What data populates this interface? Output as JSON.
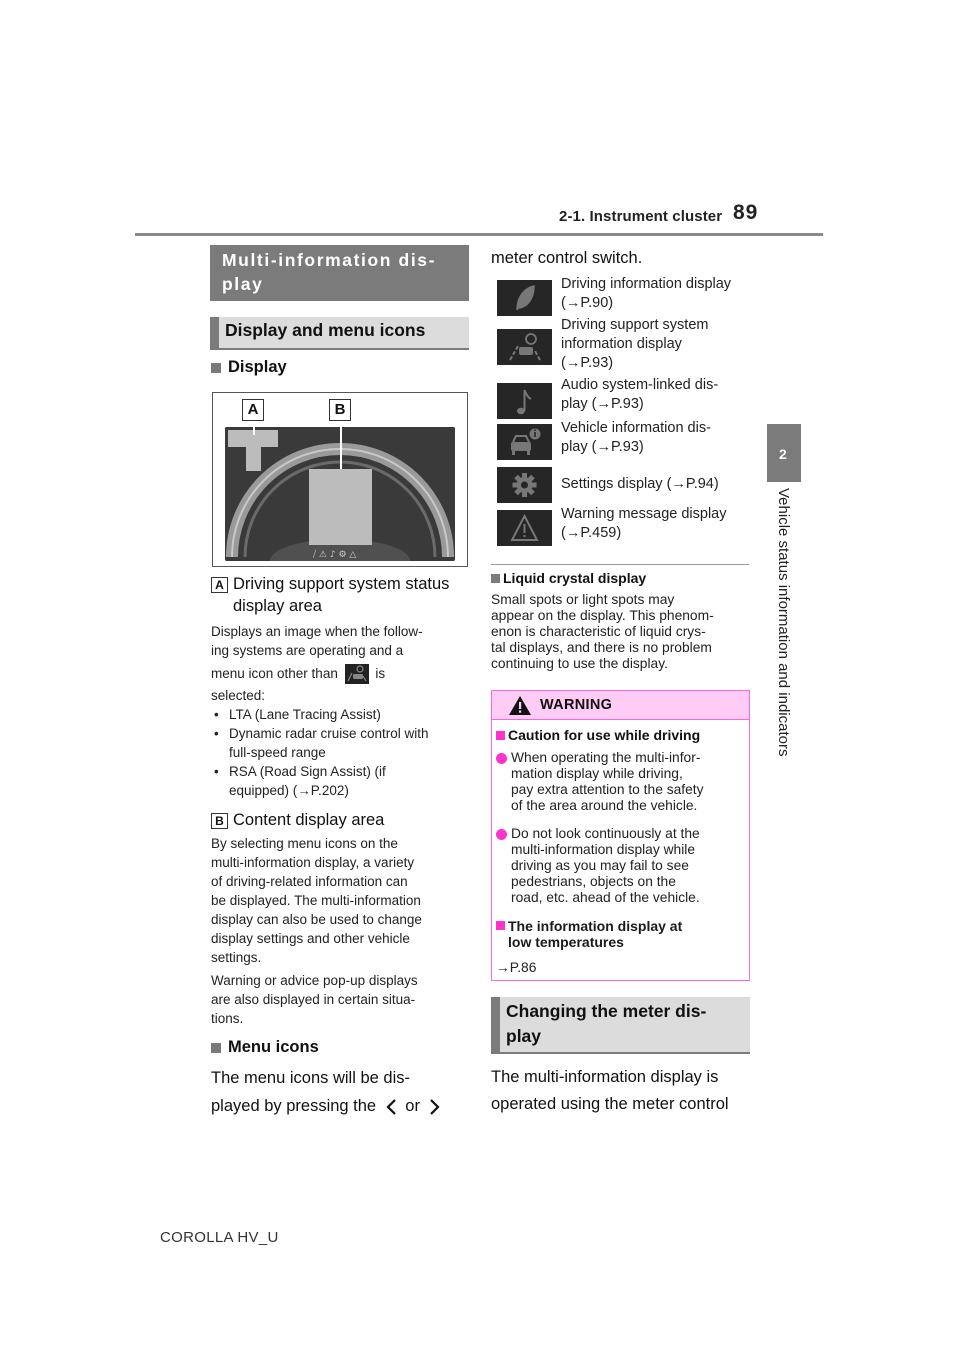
{
  "header": {
    "section": "2-1. Instrument cluster",
    "page_number": "89"
  },
  "side_tab": {
    "chapter_number": "2",
    "chapter_title": "Vehicle status information and indicators"
  },
  "left": {
    "main_heading": [
      "Multi-information dis-",
      "play"
    ],
    "sub_heading": "Display and menu icons",
    "display_heading": "Display",
    "figure": {
      "label_a": "A",
      "label_b": "B"
    },
    "item_a": {
      "label": "A",
      "title_line1": "Driving support system status",
      "title_line2": "display area",
      "desc_line1": "Displays an image when the follow-",
      "desc_line2": "ing systems are operating and a",
      "desc_line3_before": "menu icon other than",
      "desc_line3_after": "is",
      "desc_line4": "selected:",
      "bullets": [
        [
          "LTA (Lane Tracing Assist)"
        ],
        [
          "Dynamic radar cruise control with",
          "full-speed range"
        ],
        [
          "RSA (Road Sign Assist) (if",
          "equipped) (→P.202)"
        ]
      ]
    },
    "item_b": {
      "label": "B",
      "title": "Content display area",
      "desc": [
        "By selecting menu icons on the",
        "multi-information display, a variety",
        "of driving-related information can",
        "be displayed. The multi-information",
        "display can also be used to change",
        "display settings and other vehicle",
        "settings."
      ],
      "desc2": [
        "Warning or advice pop-up displays",
        "are also displayed in certain situa-",
        "tions."
      ]
    },
    "menu_icons_heading": "Menu icons",
    "menu_icons_text_line1": "The menu icons will be dis-",
    "menu_icons_text_line2_before": "played by pressing the",
    "menu_icons_text_or": "or"
  },
  "right": {
    "continuation": "meter control switch.",
    "menu_items": [
      {
        "icon": "leaf-icon",
        "lines": [
          "Driving information display",
          "(→P.90)"
        ]
      },
      {
        "icon": "driving-support-icon",
        "lines": [
          "Driving support system",
          "information display",
          "(→P.93)"
        ]
      },
      {
        "icon": "music-note-icon",
        "lines": [
          "Audio system-linked dis-",
          "play (→P.93)"
        ]
      },
      {
        "icon": "vehicle-info-icon",
        "lines": [
          "Vehicle information dis-",
          "play (→P.93)"
        ]
      },
      {
        "icon": "gear-icon",
        "lines": [
          "Settings display (→P.94)"
        ]
      },
      {
        "icon": "warning-triangle-icon",
        "lines": [
          "Warning message display",
          "(→P.459)"
        ]
      }
    ],
    "lcd_heading": "Liquid crystal display",
    "lcd_text": [
      "Small spots or light spots may",
      "appear on the display. This phenom-",
      "enon is characteristic of liquid crys-",
      "tal displays, and there is no problem",
      "continuing to use the display."
    ],
    "warning": {
      "title": "WARNING",
      "caution_heading": "Caution for use while driving",
      "bullet1": [
        "When operating the multi-infor-",
        "mation display while driving,",
        "pay extra attention to the safety",
        "of the area around the vehicle."
      ],
      "bullet2": [
        "Do not look continuously at the",
        "multi-information display while",
        "driving as you may fail to see",
        "pedestrians, objects on the",
        "road, etc. ahead of the vehicle."
      ],
      "low_temp_heading": [
        "The information display at",
        "low temperatures"
      ],
      "low_temp_ref": "→P.86"
    },
    "changing_heading": [
      "Changing the meter dis-",
      "play"
    ],
    "changing_text": [
      "The multi-information display is",
      "operated using the meter control"
    ]
  },
  "footer": {
    "model": "COROLLA HV_U"
  },
  "colors": {
    "heading_gray": "#7b7b7b",
    "subheading_bg": "#dcdcdc",
    "warning_pink": "#ff33cc",
    "warning_header_bg": "#ffccf5"
  }
}
